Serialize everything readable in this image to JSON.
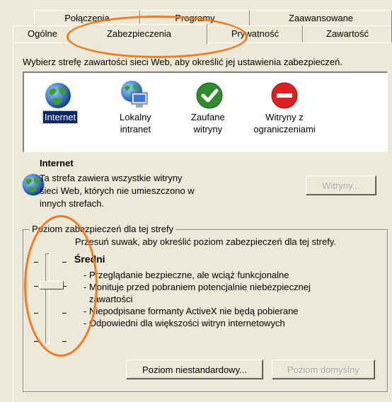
{
  "tabs": {
    "row1": [
      {
        "label": "Połączenia"
      },
      {
        "label": "Programy"
      },
      {
        "label": "Zaawansowane"
      }
    ],
    "row2": [
      {
        "label": "Ogólne"
      },
      {
        "label": "Zabezpieczenia",
        "active": true
      },
      {
        "label": "Prywatność"
      },
      {
        "label": "Zawartość"
      }
    ]
  },
  "intro": "Wybierz strefę zawartości sieci Web, aby określić jej ustawienia zabezpieczeń.",
  "zones": [
    {
      "label": "Internet",
      "icon": "globe-icon",
      "selected": true
    },
    {
      "label": "Lokalny\nintranet",
      "icon": "intranet-icon"
    },
    {
      "label": "Zaufane\nwitryny",
      "icon": "checkmark-icon"
    },
    {
      "label": "Witryny z\nograniczeniami",
      "icon": "restricted-icon"
    }
  ],
  "info": {
    "title": "Internet",
    "description": "Ta strefa zawiera wszystkie witryny\nsieci Web, których nie umieszczono w\ninnych strefach.",
    "sites_button": "Witryny..."
  },
  "security_level": {
    "group_title": "Poziom zabezpieczeń dla tej strefy",
    "hint": "Przesuń suwak, aby określić poziom zabezpieczeń dla tej strefy.",
    "level_name": "Średni",
    "bullets": [
      "- Przeglądanie bezpieczne, ale wciąż funkcjonalne",
      "- Monituje przed pobraniem potencjalnie niebezpiecznej",
      "  zawartości",
      "- Niepodpisane formanty ActiveX nie będą pobierane",
      "- Odpowiedni dla większości witryn internetowych"
    ],
    "custom_button": "Poziom niestandardowy...",
    "default_button": "Poziom domyślny"
  },
  "colors": {
    "dialog_bg": "#ece9d8",
    "selection": "#0a246a",
    "annotation": "#f07a1c"
  }
}
